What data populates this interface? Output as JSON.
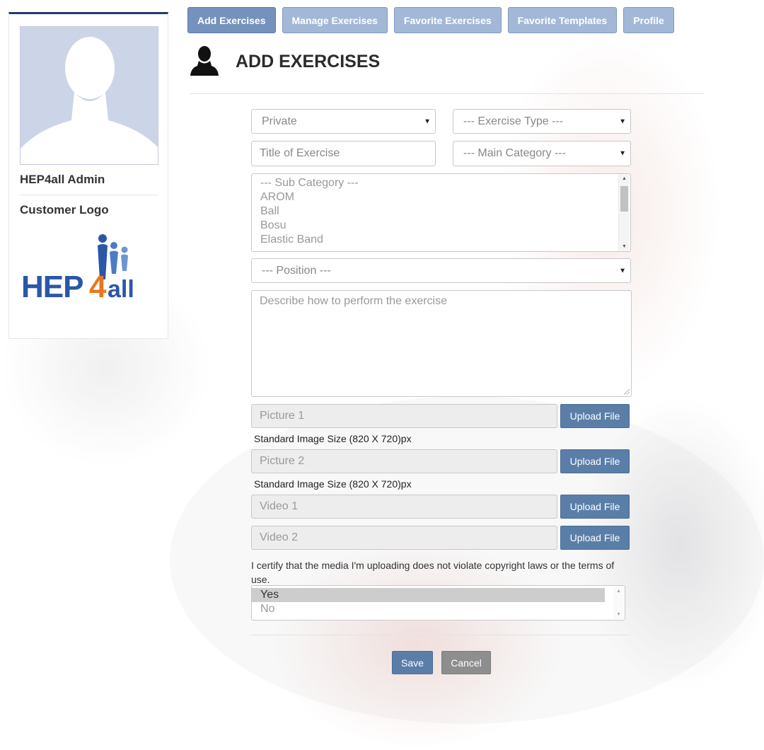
{
  "nav": {
    "items": [
      {
        "label": "Add Exercises",
        "active": true
      },
      {
        "label": "Manage Exercises",
        "active": false
      },
      {
        "label": "Favorite Exercises",
        "active": false
      },
      {
        "label": "Favorite Templates",
        "active": false
      },
      {
        "label": "Profile",
        "active": false
      }
    ]
  },
  "sidebar": {
    "user_name": "HEP4all Admin",
    "logo_heading": "Customer Logo",
    "logo_text": "HEP4all",
    "logo_colors": {
      "blue": "#2b57a7",
      "orange": "#e8781e"
    }
  },
  "page": {
    "title": "ADD EXERCISES",
    "icon": "user-silhouette-icon"
  },
  "form": {
    "visibility_select": {
      "value": "Private"
    },
    "exercise_type_select": {
      "value": "--- Exercise Type ---"
    },
    "title_input": {
      "placeholder": "Title of Exercise"
    },
    "main_category_select": {
      "value": "--- Main Category ---"
    },
    "sub_category_list": {
      "options": [
        "--- Sub Category ---",
        "AROM",
        "Ball",
        "Bosu",
        "Elastic Band"
      ]
    },
    "position_select": {
      "value": "--- Position ---"
    },
    "description": {
      "placeholder": "Describe how to perform the exercise"
    },
    "picture1": {
      "placeholder": "Picture 1",
      "button": "Upload File",
      "note": "Standard Image Size (820 X 720)px"
    },
    "picture2": {
      "placeholder": "Picture 2",
      "button": "Upload File",
      "note": "Standard Image Size (820 X 720)px"
    },
    "video1": {
      "placeholder": "Video 1",
      "button": "Upload File"
    },
    "video2": {
      "placeholder": "Video 2",
      "button": "Upload File"
    },
    "certify_text": "I certify that the media I'm uploading does not violate copyright laws or the terms of use.",
    "certify_options": [
      {
        "label": "Yes",
        "selected": true
      },
      {
        "label": "No",
        "selected": false
      }
    ],
    "save_label": "Save",
    "cancel_label": "Cancel"
  },
  "colors": {
    "primary_button": "#5b7ea9",
    "nav_button": "#a3b8d6",
    "nav_button_active": "#7592bd",
    "sidebar_top_border": "#1f3d6b",
    "cancel_button": "#8e8e8e"
  }
}
